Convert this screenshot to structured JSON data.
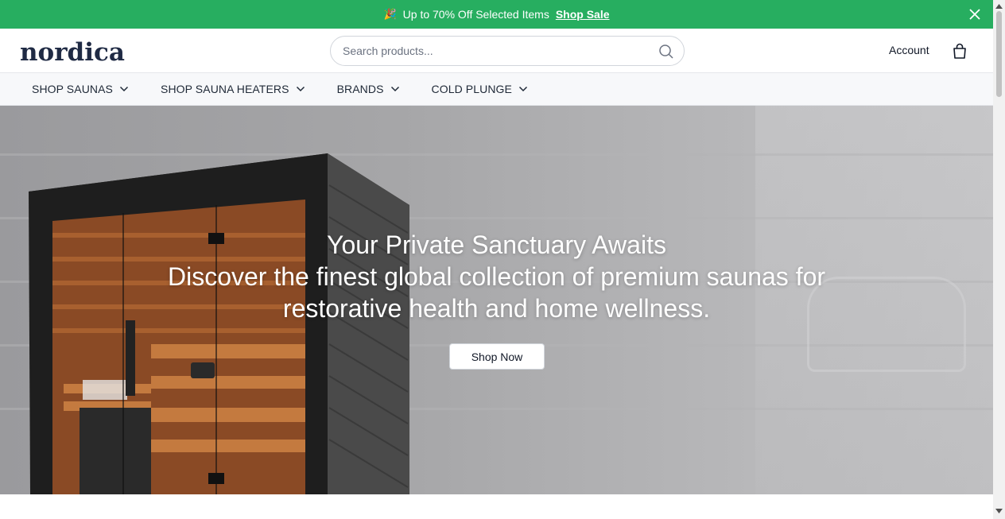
{
  "announcement": {
    "emoji": "🎉",
    "text": "Up to 70% Off Selected Items",
    "link_label": "Shop Sale"
  },
  "header": {
    "logo": "nordica",
    "search_placeholder": "Search products...",
    "account_label": "Account"
  },
  "nav": {
    "items": [
      {
        "label": "SHOP SAUNAS"
      },
      {
        "label": "SHOP SAUNA HEATERS"
      },
      {
        "label": "BRANDS"
      },
      {
        "label": "COLD PLUNGE"
      }
    ]
  },
  "hero": {
    "title": "Your Private Sanctuary Awaits",
    "subtitle_line1": "Discover the finest global collection of premium saunas for",
    "subtitle_line2": "restorative health and home wellness.",
    "cta_label": "Shop Now"
  },
  "colors": {
    "announcement_bg": "#27ae60",
    "logo": "#1f2a44",
    "nav_bg": "#f7f8fa"
  },
  "icons": [
    "party-popper-icon",
    "close-icon",
    "search-icon",
    "shopping-bag-icon",
    "chevron-down-icon"
  ]
}
